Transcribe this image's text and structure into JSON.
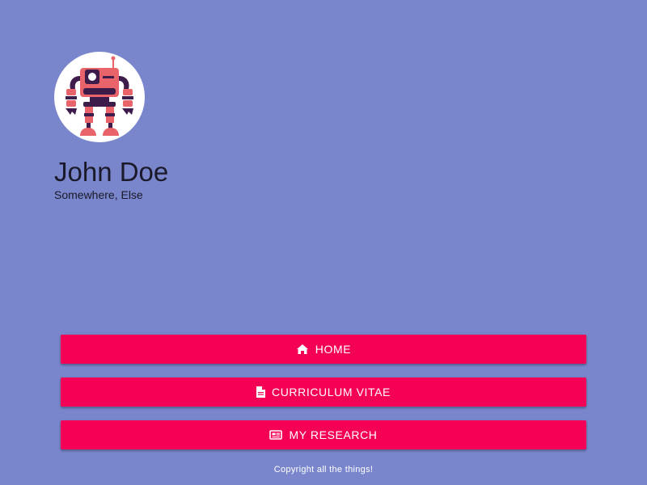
{
  "profile": {
    "avatar_icon": "robot-icon",
    "name": "John Doe",
    "location": "Somewhere, Else"
  },
  "nav": {
    "items": [
      {
        "label": "HOME",
        "icon": "home-icon"
      },
      {
        "label": "CURRICULUM VITAE",
        "icon": "document-icon"
      },
      {
        "label": "MY RESEARCH",
        "icon": "newspaper-icon"
      }
    ]
  },
  "footer": {
    "text": "Copyright all the things!"
  },
  "colors": {
    "background": "#7986cb",
    "button": "#f50057",
    "avatar_bg": "#ffffff"
  }
}
